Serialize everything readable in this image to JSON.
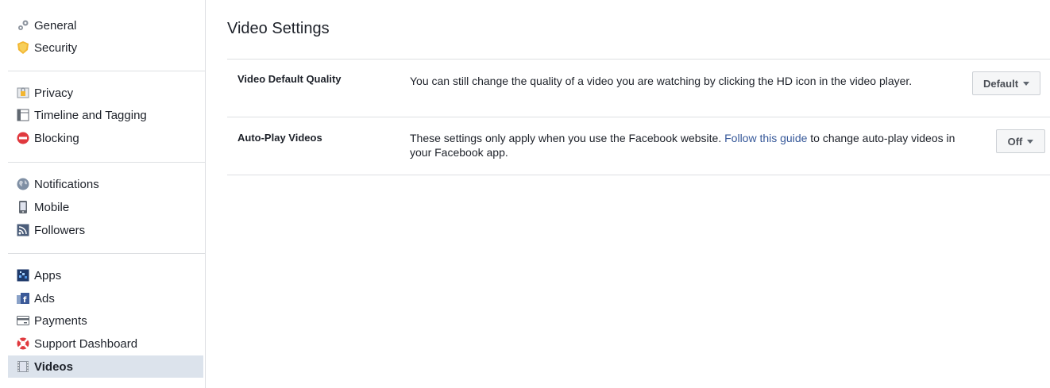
{
  "sidebar": {
    "groups": [
      {
        "items": [
          {
            "label": "General",
            "icon": "gear-icon"
          },
          {
            "label": "Security",
            "icon": "badge-icon"
          }
        ]
      },
      {
        "items": [
          {
            "label": "Privacy",
            "icon": "lock-icon"
          },
          {
            "label": "Timeline and Tagging",
            "icon": "timeline-icon"
          },
          {
            "label": "Blocking",
            "icon": "block-icon"
          }
        ]
      },
      {
        "items": [
          {
            "label": "Notifications",
            "icon": "globe-icon"
          },
          {
            "label": "Mobile",
            "icon": "mobile-icon"
          },
          {
            "label": "Followers",
            "icon": "rss-icon"
          }
        ]
      },
      {
        "items": [
          {
            "label": "Apps",
            "icon": "apps-icon"
          },
          {
            "label": "Ads",
            "icon": "ads-icon"
          },
          {
            "label": "Payments",
            "icon": "card-icon"
          },
          {
            "label": "Support Dashboard",
            "icon": "lifebuoy-icon"
          },
          {
            "label": "Videos",
            "icon": "film-icon",
            "selected": true
          }
        ]
      }
    ]
  },
  "main": {
    "title": "Video Settings",
    "rows": [
      {
        "label": "Video Default Quality",
        "description": "You can still change the quality of a video you are watching by clicking the HD icon in the video player.",
        "value": "Default"
      },
      {
        "label": "Auto-Play Videos",
        "description_before": "These settings only apply when you use the Facebook website. ",
        "link": "Follow this guide",
        "description_after": " to change auto-play videos in your Facebook app.",
        "value": "Off"
      }
    ]
  },
  "colors": {
    "link": "#365899",
    "selected_bg": "#dce3ec",
    "divider": "#dddfe2"
  }
}
